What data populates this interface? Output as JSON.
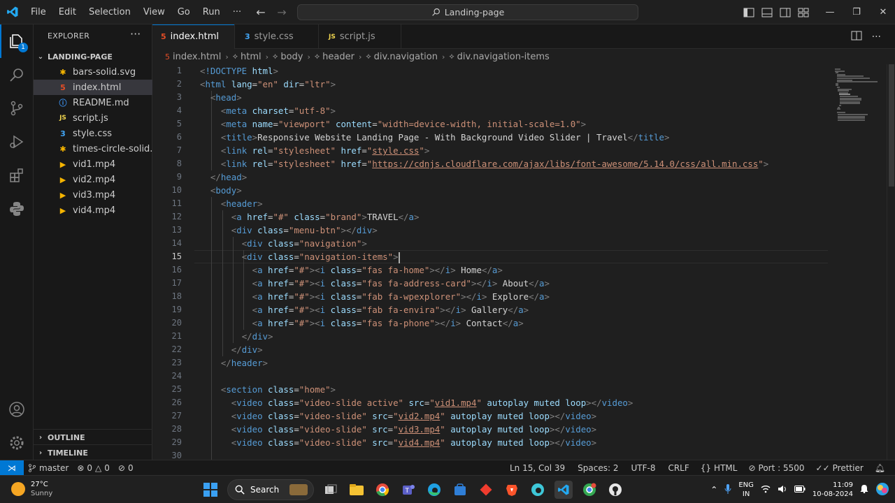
{
  "title_bar": {
    "menu": [
      "File",
      "Edit",
      "Selection",
      "View",
      "Go",
      "Run",
      "···"
    ],
    "search_text": "Landing-page",
    "window_controls": [
      "—",
      "❐",
      "✕"
    ]
  },
  "activity_bar": {
    "explorer_badge": "1"
  },
  "sidebar": {
    "title": "EXPLORER",
    "more": "···",
    "folder": "LANDING-PAGE",
    "files": [
      {
        "name": "bars-solid.svg",
        "icon": "star-icon",
        "color": "#f5b400"
      },
      {
        "name": "index.html",
        "icon": "html-icon",
        "color": "#e44d26",
        "selected": true
      },
      {
        "name": "README.md",
        "icon": "info-icon",
        "color": "#3b8eea"
      },
      {
        "name": "script.js",
        "icon": "js-icon",
        "color": "#f1d64f"
      },
      {
        "name": "style.css",
        "icon": "css-icon",
        "color": "#42a5f5"
      },
      {
        "name": "times-circle-solid...",
        "icon": "star-icon",
        "color": "#f5b400"
      },
      {
        "name": "vid1.mp4",
        "icon": "video-icon",
        "color": "#f5b400"
      },
      {
        "name": "vid2.mp4",
        "icon": "video-icon",
        "color": "#f5b400"
      },
      {
        "name": "vid3.mp4",
        "icon": "video-icon",
        "color": "#f5b400"
      },
      {
        "name": "vid4.mp4",
        "icon": "video-icon",
        "color": "#f5b400"
      }
    ],
    "outline": "OUTLINE",
    "timeline": "TIMELINE"
  },
  "tabs": [
    {
      "label": "index.html",
      "icon": "html-icon",
      "color": "#e44d26",
      "active": true,
      "modified": true
    },
    {
      "label": "style.css",
      "icon": "css-icon",
      "color": "#42a5f5"
    },
    {
      "label": "script.js",
      "icon": "js-icon",
      "color": "#f1d64f"
    }
  ],
  "breadcrumb": [
    "index.html",
    "html",
    "body",
    "header",
    "div.navigation",
    "div.navigation-items"
  ],
  "editor": {
    "current_line": 15,
    "lines": [
      "1",
      "2",
      "3",
      "4",
      "5",
      "6",
      "7",
      "8",
      "9",
      "10",
      "11",
      "12",
      "13",
      "14",
      "15",
      "16",
      "17",
      "18",
      "19",
      "20",
      "21",
      "22",
      "23",
      "24",
      "25",
      "26",
      "27",
      "28",
      "29",
      "30"
    ],
    "code": {
      "l1_a": "<!DOCTYPE ",
      "l1_b": "html",
      "l1_c": ">",
      "doc_title": "Responsive Website Landing Page - With Background Video Slider | Travel",
      "brand_text": "TRAVEL",
      "nav_home": " Home",
      "nav_about": " About",
      "nav_explore": " Explore",
      "nav_gallery": " Gallery",
      "nav_contact": " Contact",
      "fa_url": "https://cdnjs.cloudflare.com/ajax/libs/font-awesome/5.14.0/css/all.min.css"
    }
  },
  "status_bar": {
    "branch": "master",
    "problems": "0",
    "warnings": "0",
    "ports_count": "0",
    "position": "Ln 15, Col 39",
    "spaces": "Spaces: 2",
    "encoding": "UTF-8",
    "eol": "CRLF",
    "language": "HTML",
    "port": "Port : 5500",
    "prettier": "Prettier"
  },
  "taskbar": {
    "temp": "27°C",
    "weather": "Sunny",
    "search": "Search",
    "lang_top": "ENG",
    "lang_bottom": "IN",
    "time": "11:09",
    "date": "10-08-2024"
  }
}
